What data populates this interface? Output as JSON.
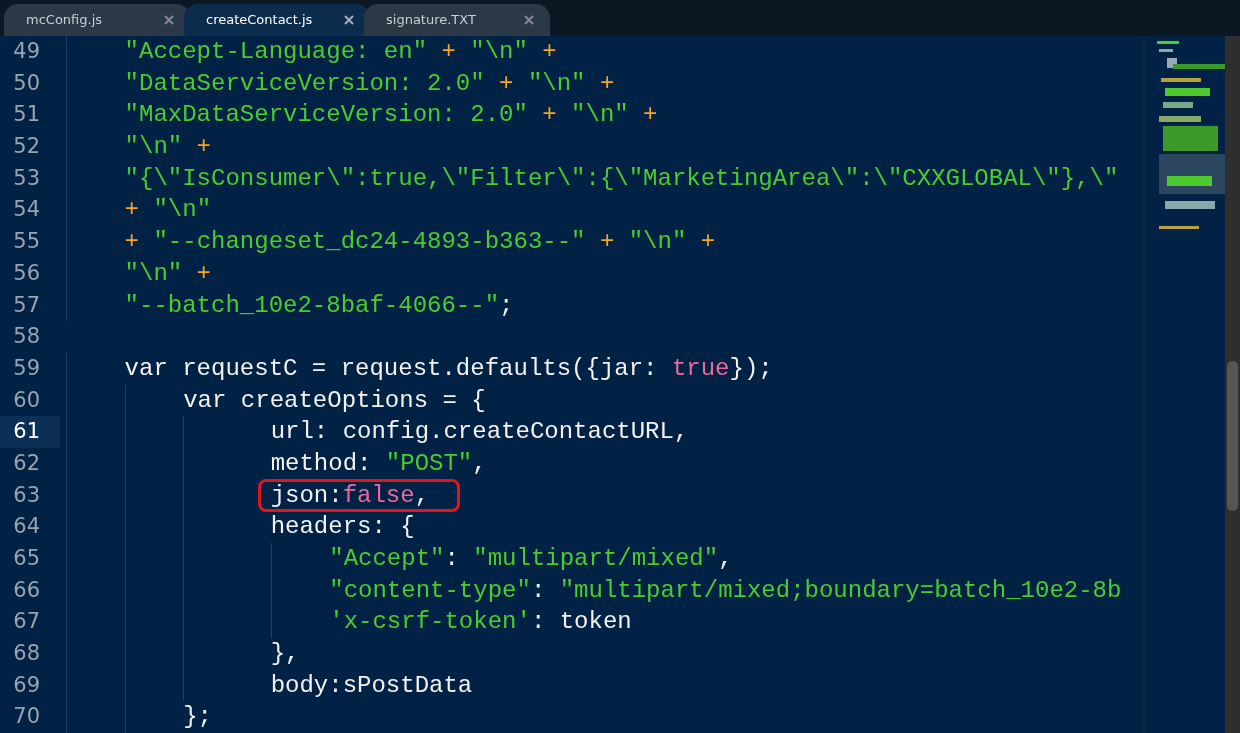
{
  "tabs": [
    {
      "label": "mcConfig.js",
      "selected": false
    },
    {
      "label": "createContact.js",
      "selected": true
    },
    {
      "label": "signature.TXT",
      "selected": false
    }
  ],
  "editor": {
    "lines": [
      {
        "number": "49",
        "current": false,
        "boxed": false,
        "tokens": [
          {
            "kind": "string",
            "text": "    \"Accept-Language: en\""
          },
          {
            "kind": "operator",
            "text": " + "
          },
          {
            "kind": "string",
            "text": "\"\\n\""
          },
          {
            "kind": "operator",
            "text": " +"
          }
        ]
      },
      {
        "number": "50",
        "current": false,
        "boxed": false,
        "tokens": [
          {
            "kind": "string",
            "text": "    \"DataServiceVersion: 2.0\""
          },
          {
            "kind": "operator",
            "text": " + "
          },
          {
            "kind": "string",
            "text": "\"\\n\""
          },
          {
            "kind": "operator",
            "text": " +"
          }
        ]
      },
      {
        "number": "51",
        "current": false,
        "boxed": false,
        "tokens": [
          {
            "kind": "string",
            "text": "    \"MaxDataServiceVersion: 2.0\""
          },
          {
            "kind": "operator",
            "text": " + "
          },
          {
            "kind": "string",
            "text": "\"\\n\""
          },
          {
            "kind": "operator",
            "text": " +"
          }
        ]
      },
      {
        "number": "52",
        "current": false,
        "boxed": false,
        "tokens": [
          {
            "kind": "string",
            "text": "    \"\\n\""
          },
          {
            "kind": "operator",
            "text": " +"
          }
        ]
      },
      {
        "number": "53",
        "current": false,
        "boxed": false,
        "tokens": [
          {
            "kind": "string",
            "text": "    \"{\\\"IsConsumer\\\":true,\\\"Filter\\\":{\\\"MarketingArea\\\":\\\"CXXGLOBAL\\\"},\\\""
          }
        ]
      },
      {
        "number": "54",
        "current": false,
        "boxed": false,
        "tokens": [
          {
            "kind": "operator",
            "text": "    + "
          },
          {
            "kind": "string",
            "text": "\"\\n\""
          }
        ]
      },
      {
        "number": "55",
        "current": false,
        "boxed": false,
        "tokens": [
          {
            "kind": "operator",
            "text": "    + "
          },
          {
            "kind": "string",
            "text": "\"--changeset_dc24-4893-b363--\""
          },
          {
            "kind": "operator",
            "text": " + "
          },
          {
            "kind": "string",
            "text": "\"\\n\""
          },
          {
            "kind": "operator",
            "text": " +"
          }
        ]
      },
      {
        "number": "56",
        "current": false,
        "boxed": false,
        "tokens": [
          {
            "kind": "string",
            "text": "    \"\\n\""
          },
          {
            "kind": "operator",
            "text": " +"
          }
        ]
      },
      {
        "number": "57",
        "current": false,
        "boxed": false,
        "tokens": [
          {
            "kind": "string",
            "text": "    \"--batch_10e2-8baf-4066--\""
          },
          {
            "kind": "plain",
            "text": ";"
          }
        ]
      },
      {
        "number": "58",
        "current": false,
        "boxed": false
      },
      {
        "number": "59",
        "current": false,
        "boxed": false,
        "tokens": [
          {
            "kind": "plain",
            "text": "    var requestC = request.defaults({jar: "
          },
          {
            "kind": "literal",
            "text": "true"
          },
          {
            "kind": "plain",
            "text": "});"
          }
        ]
      },
      {
        "number": "60",
        "current": false,
        "boxed": false,
        "tokens": [
          {
            "kind": "plain",
            "text": "        var createOptions = {"
          }
        ]
      },
      {
        "number": "61",
        "current": true,
        "boxed": false,
        "tokens": [
          {
            "kind": "plain",
            "text": "              url: config.createContactURL,"
          }
        ]
      },
      {
        "number": "62",
        "current": false,
        "boxed": false,
        "tokens": [
          {
            "kind": "plain",
            "text": "              method: "
          },
          {
            "kind": "string",
            "text": "\"POST\""
          },
          {
            "kind": "plain",
            "text": ","
          }
        ]
      },
      {
        "number": "63",
        "current": false,
        "boxed": true,
        "tokens": [
          {
            "kind": "plain",
            "text": "              json:"
          },
          {
            "kind": "literal",
            "text": "false"
          },
          {
            "kind": "plain",
            "text": ","
          }
        ]
      },
      {
        "number": "64",
        "current": false,
        "boxed": false,
        "tokens": [
          {
            "kind": "plain",
            "text": "              headers: {"
          }
        ]
      },
      {
        "number": "65",
        "current": false,
        "boxed": false,
        "tokens": [
          {
            "kind": "string",
            "text": "                  \"Accept\""
          },
          {
            "kind": "plain",
            "text": ": "
          },
          {
            "kind": "string",
            "text": "\"multipart/mixed\""
          },
          {
            "kind": "plain",
            "text": ","
          }
        ]
      },
      {
        "number": "66",
        "current": false,
        "boxed": false,
        "tokens": [
          {
            "kind": "string",
            "text": "                  \"content-type\""
          },
          {
            "kind": "plain",
            "text": ": "
          },
          {
            "kind": "string",
            "text": "\"multipart/mixed;boundary=batch_10e2-8b"
          }
        ]
      },
      {
        "number": "67",
        "current": false,
        "boxed": false,
        "tokens": [
          {
            "kind": "string",
            "text": "                  'x-csrf-token'"
          },
          {
            "kind": "plain",
            "text": ": token"
          }
        ]
      },
      {
        "number": "68",
        "current": false,
        "boxed": false,
        "tokens": [
          {
            "kind": "plain",
            "text": "              },"
          }
        ]
      },
      {
        "number": "69",
        "current": false,
        "boxed": false,
        "tokens": [
          {
            "kind": "plain",
            "text": "              body:sPostData"
          }
        ]
      },
      {
        "number": "70",
        "current": false,
        "boxed": false,
        "tokens": [
          {
            "kind": "plain",
            "text": "        };"
          }
        ]
      }
    ]
  }
}
